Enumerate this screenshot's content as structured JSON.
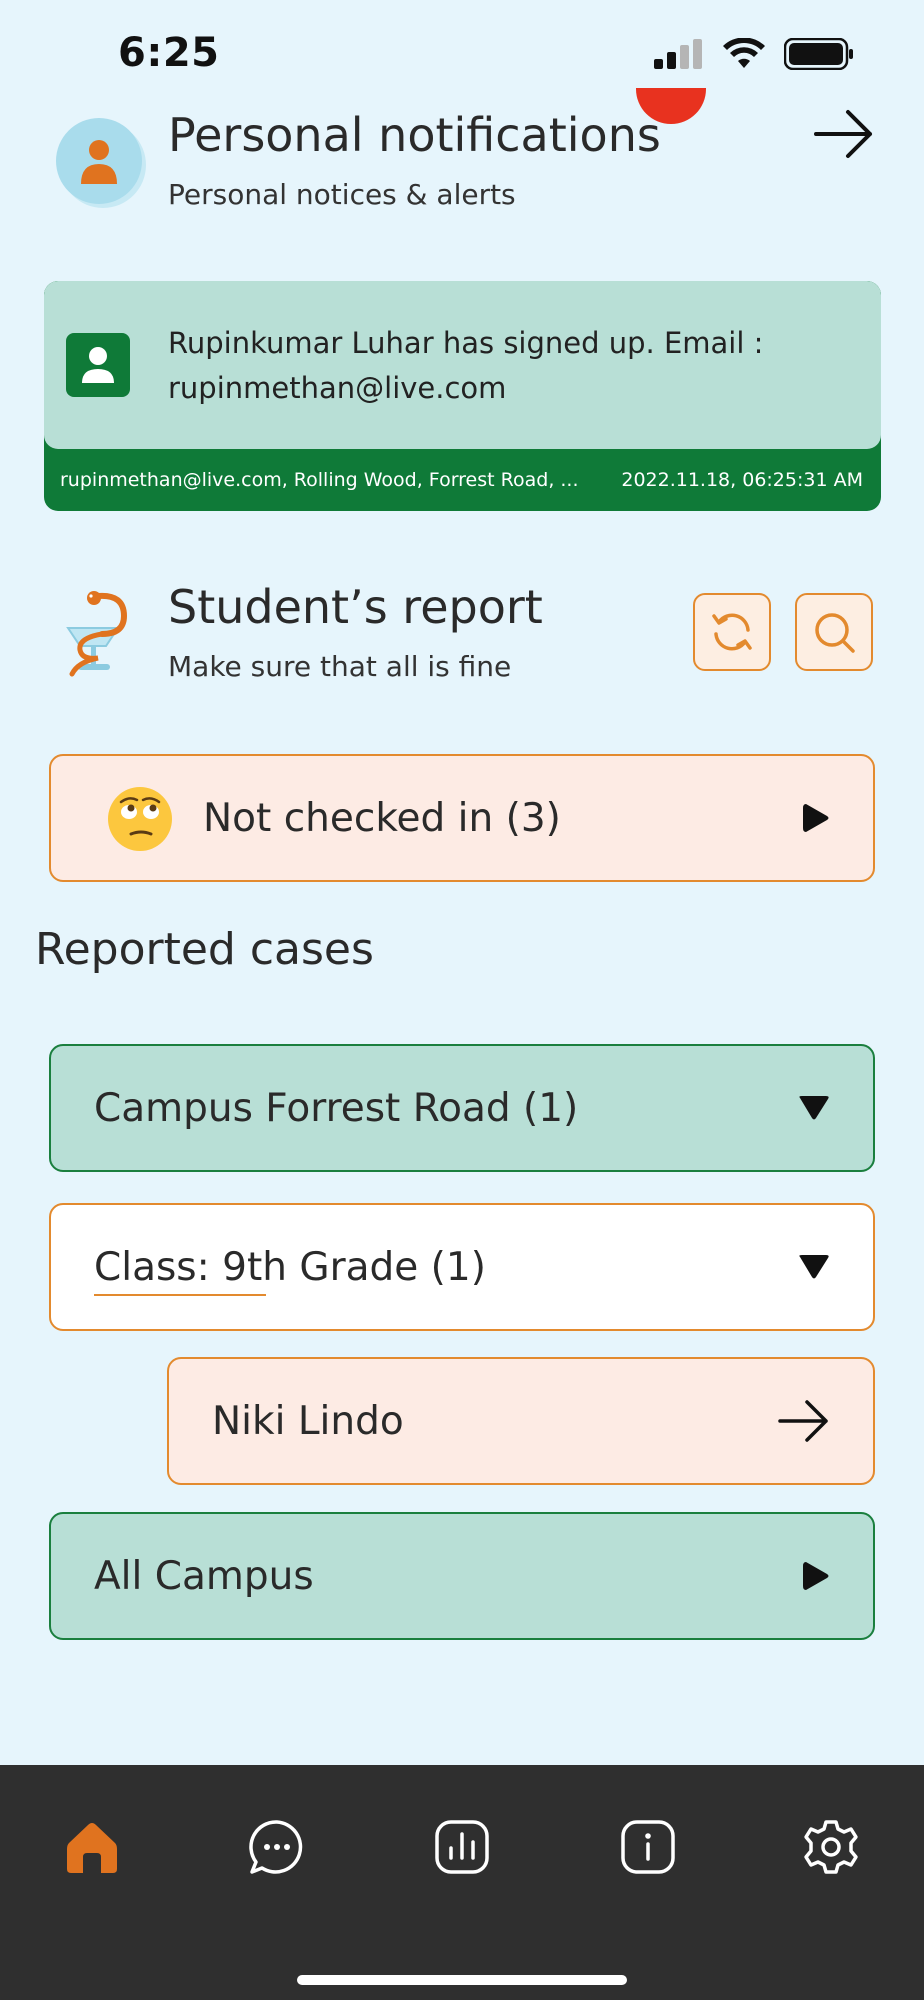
{
  "status_bar": {
    "time": "6:25"
  },
  "personal": {
    "title": "Personal notifications",
    "subtitle": "Personal notices & alerts"
  },
  "notification": {
    "message": "Rupinkumar Luhar has signed up. Email : rupinmethan@live.com",
    "footer_left": "rupinmethan@live.com, Rolling Wood, Forrest Road, ...",
    "footer_right": "2022.11.18, 06:25:31 AM"
  },
  "report": {
    "title": "Student’s report",
    "subtitle": "Make sure that all is fine"
  },
  "not_checked": {
    "label": "Not checked in (3)"
  },
  "reported_cases": {
    "title": "Reported cases",
    "campus": "Campus Forrest Road (1)",
    "class": "Class: 9th Grade (1)",
    "student": "Niki Lindo",
    "all_campus": "All Campus"
  },
  "colors": {
    "accent_orange": "#e38a2e",
    "brand_green": "#0f7a38",
    "mint": "#b8dfd6",
    "peach": "#fdebe4",
    "badge_red": "#e8321f",
    "nav_bg": "#2f2f2f"
  },
  "bottom_nav": {
    "items": [
      "home-icon",
      "chat-icon",
      "chart-icon",
      "info-icon",
      "settings-icon"
    ],
    "active": "home-icon"
  }
}
